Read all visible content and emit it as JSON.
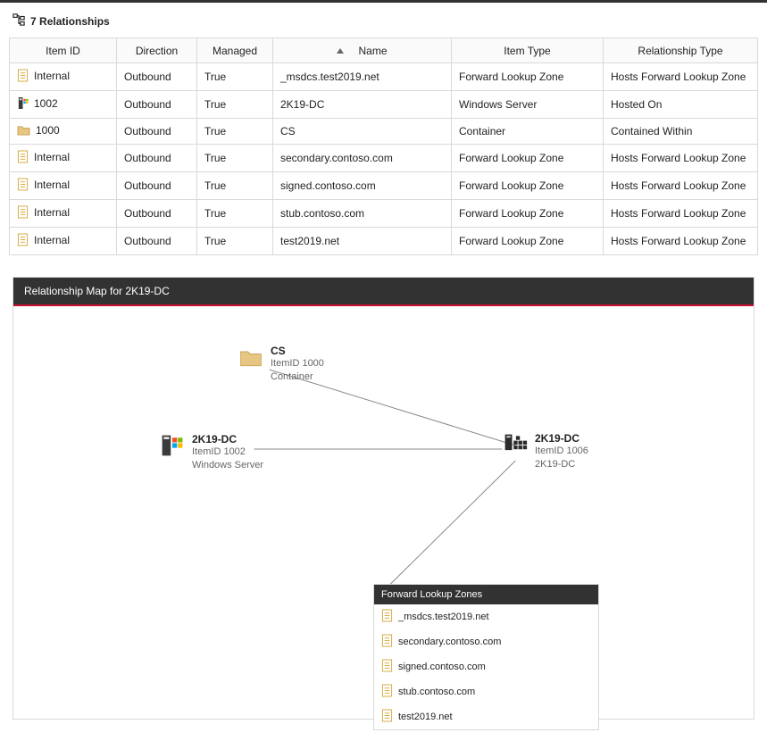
{
  "header": {
    "count": 7,
    "title": "Relationships"
  },
  "columns": {
    "item_id": "Item ID",
    "direction": "Direction",
    "managed": "Managed",
    "name": "Name",
    "item_type": "Item Type",
    "relationship_type": "Relationship Type"
  },
  "rows": [
    {
      "icon": "document",
      "item_id": "Internal",
      "direction": "Outbound",
      "managed": "True",
      "name": "_msdcs.test2019.net",
      "item_type": "Forward Lookup Zone",
      "relationship_type": "Hosts Forward Lookup Zone"
    },
    {
      "icon": "server",
      "item_id": "1002",
      "direction": "Outbound",
      "managed": "True",
      "name": "2K19-DC",
      "item_type": "Windows Server",
      "relationship_type": "Hosted On"
    },
    {
      "icon": "folder",
      "item_id": "1000",
      "direction": "Outbound",
      "managed": "True",
      "name": "CS",
      "item_type": "Container",
      "relationship_type": "Contained Within"
    },
    {
      "icon": "document",
      "item_id": "Internal",
      "direction": "Outbound",
      "managed": "True",
      "name": "secondary.contoso.com",
      "item_type": "Forward Lookup Zone",
      "relationship_type": "Hosts Forward Lookup Zone"
    },
    {
      "icon": "document",
      "item_id": "Internal",
      "direction": "Outbound",
      "managed": "True",
      "name": "signed.contoso.com",
      "item_type": "Forward Lookup Zone",
      "relationship_type": "Hosts Forward Lookup Zone"
    },
    {
      "icon": "document",
      "item_id": "Internal",
      "direction": "Outbound",
      "managed": "True",
      "name": "stub.contoso.com",
      "item_type": "Forward Lookup Zone",
      "relationship_type": "Hosts Forward Lookup Zone"
    },
    {
      "icon": "document",
      "item_id": "Internal",
      "direction": "Outbound",
      "managed": "True",
      "name": "test2019.net",
      "item_type": "Forward Lookup Zone",
      "relationship_type": "Hosts Forward Lookup Zone"
    }
  ],
  "panel": {
    "title": "Relationship Map for 2K19-DC",
    "nodes": {
      "cs": {
        "title": "CS",
        "line1": "ItemID 1000",
        "line2": "Container"
      },
      "server": {
        "title": "2K19-DC",
        "line1": "ItemID 1002",
        "line2": "Windows Server"
      },
      "center": {
        "title": "2K19-DC",
        "line1": "ItemID 1006",
        "line2": "2K19-DC"
      }
    },
    "flz": {
      "title": "Forward Lookup Zones",
      "items": [
        "_msdcs.test2019.net",
        "secondary.contoso.com",
        "signed.contoso.com",
        "stub.contoso.com",
        "test2019.net"
      ]
    }
  }
}
